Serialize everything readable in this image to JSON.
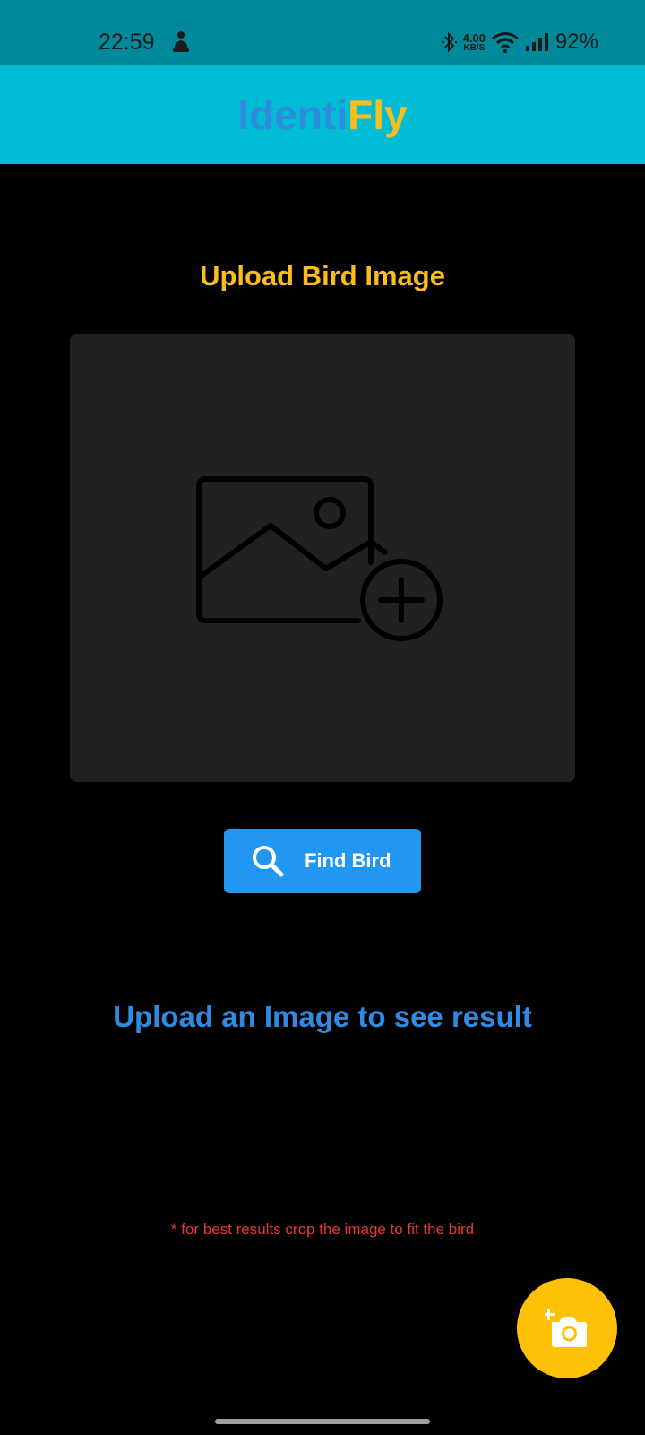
{
  "status_bar": {
    "time": "22:59",
    "left_icon": "notification-figure-icon",
    "bluetooth_icon": "bluetooth-icon",
    "speed_value": "4.00",
    "speed_unit": "KB/S",
    "wifi_icon": "wifi-icon",
    "signal_icon": "cell-signal-icon",
    "battery": "92%"
  },
  "app_bar": {
    "title_part1": "Identi",
    "title_part2": "Fly",
    "title_color_1": "#2f8ae0",
    "title_color_2": "#f9bd20",
    "background": "#00bcd4"
  },
  "main": {
    "section_title": "Upload Bird Image",
    "image_placeholder_icon": "add-photo-icon",
    "find_button": {
      "icon": "search-icon",
      "label": "Find Bird",
      "color": "#2196f3"
    },
    "result_text": "Upload an Image to see result",
    "hint_text": "* for best results crop the image to fit the bird"
  },
  "fab": {
    "icon": "add-camera-icon",
    "color": "#ffc107"
  }
}
